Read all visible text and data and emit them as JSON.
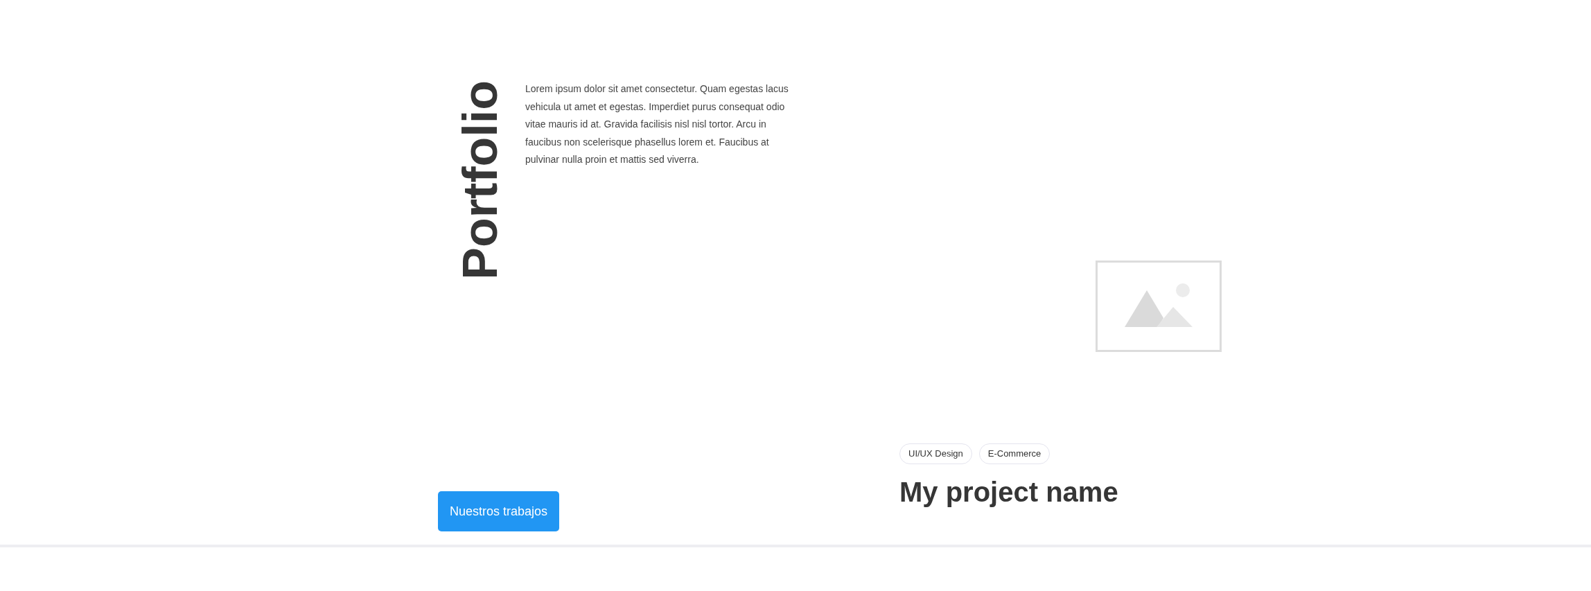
{
  "heading": "Portfolio",
  "intro": "Lorem ipsum dolor sit amet consectetur. Quam egestas lacus vehicula ut amet et egestas. Imperdiet purus consequat odio vitae mauris id at. Gravida facilisis nisl nisl tortor. Arcu in faucibus non scelerisque phasellus lorem et. Faucibus at pulvinar nulla proin et mattis sed viverra.",
  "button": "Nuestros trabajos",
  "project": {
    "image": {
      "kind": "placeholder"
    },
    "tags": [
      "UI/UX Design",
      "E-Commerce"
    ],
    "title": "My project name"
  }
}
